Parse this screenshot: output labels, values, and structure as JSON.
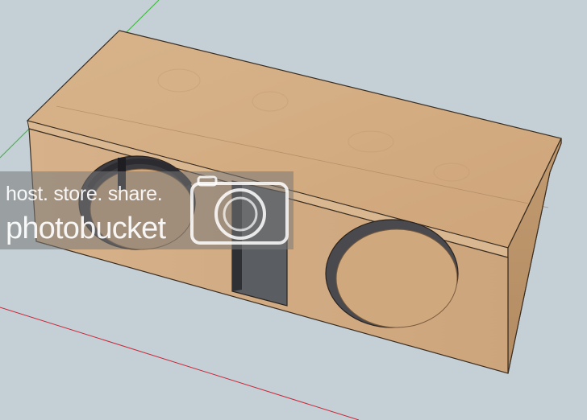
{
  "scene": {
    "object": "subwoofer-enclosure",
    "background_color": "#c4cfd6",
    "wood_color": "#d2ad85"
  },
  "watermark": {
    "tagline": "host. store. share.",
    "brand": "photobucket",
    "icon": "camera-icon"
  }
}
